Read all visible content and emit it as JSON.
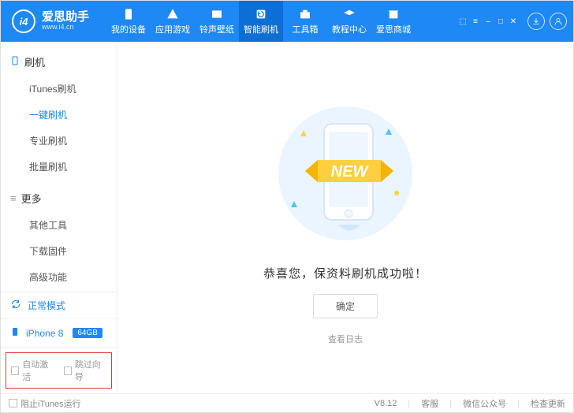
{
  "brand": {
    "zh": "爱思助手",
    "en": "www.i4.cn",
    "badge": "i4"
  },
  "topnav": [
    {
      "label": "我的设备"
    },
    {
      "label": "应用游戏"
    },
    {
      "label": "铃声壁纸"
    },
    {
      "label": "智能刷机"
    },
    {
      "label": "工具箱"
    },
    {
      "label": "教程中心"
    },
    {
      "label": "爱思商城"
    }
  ],
  "sidebar": {
    "section1": {
      "title": "刷机",
      "items": [
        "iTunes刷机",
        "一键刷机",
        "专业刷机",
        "批量刷机"
      ],
      "active": 1
    },
    "section2": {
      "title": "更多",
      "items": [
        "其他工具",
        "下载固件",
        "高级功能"
      ]
    }
  },
  "device": {
    "mode": "正常模式",
    "name": "iPhone 8",
    "storage": "64GB"
  },
  "checks": {
    "auto_activate": "自动激活",
    "skip_wizard": "跳过向导"
  },
  "content": {
    "success": "恭喜您，保资料刷机成功啦！",
    "ok": "确定",
    "log": "查看日志",
    "banner": "NEW"
  },
  "status": {
    "block_itunes": "阻止iTunes运行",
    "version": "V8.12",
    "items": [
      "客服",
      "微信公众号",
      "检查更新"
    ]
  }
}
